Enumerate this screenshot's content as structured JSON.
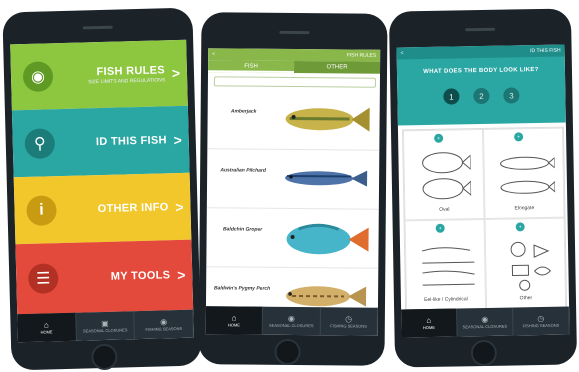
{
  "phone1": {
    "menu": [
      {
        "label": "FISH RULES",
        "sub": "SIZE LIMITS AND REGULATIONS",
        "color": "#8dc63f",
        "circle": "#5f9a24",
        "icon": "fish-icon"
      },
      {
        "label": "ID THIS FISH",
        "sub": "",
        "color": "#2aa6a3",
        "circle": "#1b7c7a",
        "icon": "search-icon"
      },
      {
        "label": "OTHER INFO",
        "sub": "",
        "color": "#f2c72c",
        "circle": "#c99b12",
        "icon": "info-icon"
      },
      {
        "label": "MY TOOLS",
        "sub": "",
        "color": "#e34a3c",
        "circle": "#b33024",
        "icon": "tools-icon"
      }
    ],
    "chevron": ">",
    "nav": [
      {
        "label": "HOME",
        "icon": "home-icon"
      },
      {
        "label": "SEASONAL CLOSURES",
        "icon": "calendar-icon"
      },
      {
        "label": "FISHING SEASONS",
        "icon": "location-icon"
      }
    ]
  },
  "phone2": {
    "topbar_left": "<",
    "topbar_right": "FISH RULES",
    "tabs": [
      "FISH",
      "OTHER"
    ],
    "fish": [
      {
        "name": "Amberjack",
        "body": "#c8b24a",
        "stripe": "#6a7b2e"
      },
      {
        "name": "Australian Pilchard",
        "body": "#4d73a8",
        "stripe": "#1d3f6e"
      },
      {
        "name": "Baldchin Groper",
        "body": "#46b5c9",
        "stripe": "#e06d2e"
      },
      {
        "name": "Baldwin's Pygmy Perch",
        "body": "#d3b06a",
        "stripe": "#7a5a2a"
      }
    ],
    "nav": [
      {
        "label": "HOME",
        "icon": "home-icon"
      },
      {
        "label": "SEASONAL CLOSURES",
        "icon": "location-icon"
      },
      {
        "label": "FISHING SEASONS",
        "icon": "clock-icon"
      }
    ]
  },
  "phone3": {
    "topbar_left": "<",
    "topbar_right": "ID THIS FISH",
    "question": "WHAT DOES THE BODY LOOK LIKE?",
    "steps": [
      "1",
      "2",
      "3"
    ],
    "shapes": [
      {
        "label": "Oval"
      },
      {
        "label": "Elongate"
      },
      {
        "label": "Eel-like / Cylindrical"
      },
      {
        "label": "Other"
      }
    ],
    "nav": [
      {
        "label": "HOME",
        "icon": "home-icon"
      },
      {
        "label": "SEASONAL CLOSURES",
        "icon": "location-icon"
      },
      {
        "label": "FISHING SEASONS",
        "icon": "clock-icon"
      }
    ]
  }
}
